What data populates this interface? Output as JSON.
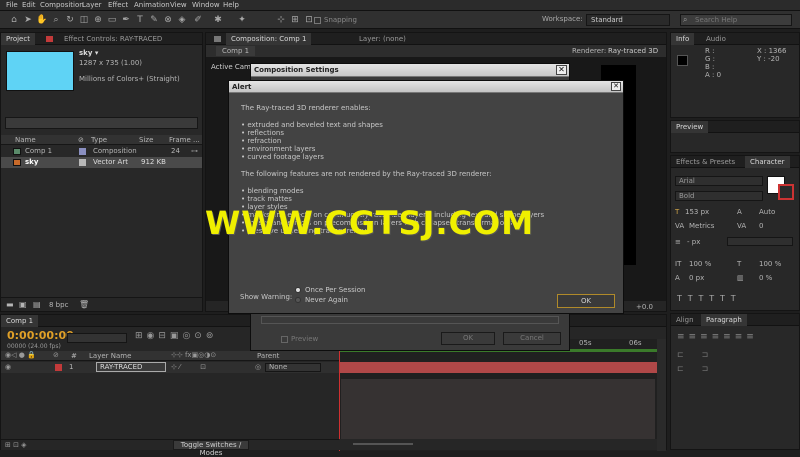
{
  "menu": [
    "File",
    "Edit",
    "Composition",
    "Layer",
    "Effect",
    "Animation",
    "View",
    "Window",
    "Help"
  ],
  "toolbar": {
    "snapping_label": "Snapping",
    "workspace_label": "Workspace:",
    "workspace_value": "Standard",
    "search_placeholder": "Search Help"
  },
  "project_panel": {
    "tab_project": "Project",
    "tab_effect_controls": "Effect Controls: RAY-TRACED",
    "item_name": "sky ▾",
    "item_dims": "1287 x 735 (1.00)",
    "item_colors": "Millions of Colors+ (Straight)",
    "thumb_color": "#5fd3f5",
    "columns": [
      "Name",
      "Type",
      "Size",
      "Frame ..."
    ],
    "items": [
      {
        "name": "Comp 1",
        "type": "Composition",
        "size": "",
        "frame": "24"
      },
      {
        "name": "sky",
        "type": "Vector Art",
        "size": "912 KB",
        "frame": ""
      }
    ],
    "bpc": "8 bpc"
  },
  "comp_viewer": {
    "tab_comp": "Composition: Comp 1",
    "tab_layer": "Layer: (none)",
    "sub_tab": "Comp 1",
    "renderer_label": "Renderer:",
    "renderer_value": "Ray-traced 3D",
    "active_camera": "Active Camera",
    "zoom_value": "+0.0"
  },
  "comp_settings": {
    "title": "Composition Settings",
    "preview_label": "Preview",
    "ok": "OK",
    "cancel": "Cancel"
  },
  "alert": {
    "title": "Alert",
    "intro": "The Ray-traced 3D renderer enables:",
    "enables": [
      "• extruded and beveled text and shapes",
      "• reflections",
      "• refraction",
      "• environment layers",
      "• curved footage layers"
    ],
    "not_rendered_intro": "The following features are not rendered by the Ray-traced 3D renderer:",
    "not_rendered": [
      "• blending modes",
      "• track mattes",
      "• layer styles"
    ],
    "obscured_lines": [
      "• masks and effects on continuously rasterized layers, including text and shape layers",
      "• masks and effects on precomposition layers with collapsed transformations",
      "• preserve underlying transparency"
    ],
    "show_warning_label": "Show Warning:",
    "options": [
      "Once Per Session",
      "Never Again"
    ],
    "ok": "OK"
  },
  "info_panel": {
    "tab_info": "Info",
    "tab_audio": "Audio",
    "r": "R :",
    "g": "G :",
    "b": "B :",
    "a": "A : 0",
    "x": "X : 1366",
    "y": "Y : -20"
  },
  "preview_panel": {
    "tab": "Preview"
  },
  "character_panel": {
    "tab_effects": "Effects & Presets",
    "tab_character": "Character",
    "font": "Arial",
    "style": "Bold",
    "size": "153 px",
    "leading": "Auto",
    "kerning": "Metrics",
    "tracking": "0",
    "stroke": "- px",
    "vscale": "100 %",
    "hscale": "100 %",
    "baseline": "0 px",
    "tsume": "0 %"
  },
  "paragraph_panel": {
    "tab_align": "Align",
    "tab_paragraph": "Paragraph"
  },
  "timeline": {
    "tab": "Comp 1",
    "timecode": "0:00:00:00",
    "fps": "00000 (24.00 fps)",
    "layer_name_col": "Layer Name",
    "parent_col": "Parent",
    "layer_index": "1",
    "layer_name": "RAY-TRACED",
    "parent_value": "None",
    "ruler_05": "05s",
    "ruler_06": "06s",
    "toggle_label": "Toggle Switches / Modes"
  },
  "watermark": "WWW.CGTSJ.COM"
}
